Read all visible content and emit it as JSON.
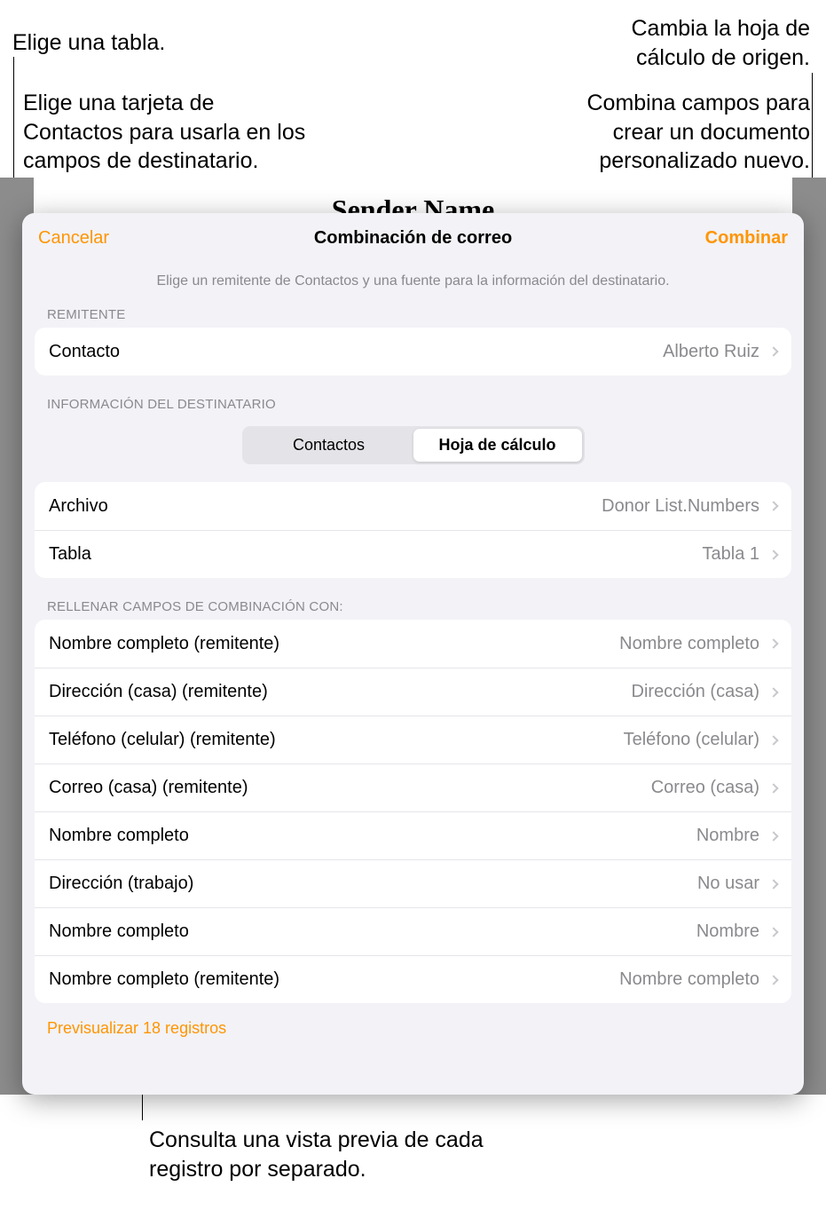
{
  "callouts": {
    "top_left_1": "Elige una tabla.",
    "top_left_2": "Elige una tarjeta de Contactos para usarla en los campos de destinatario.",
    "top_right_1": "Cambia la hoja de cálculo de origen.",
    "top_right_2": "Combina campos para crear un documento personalizado nuevo.",
    "bottom": "Consulta una vista previa de cada registro por separado."
  },
  "document": {
    "title_behind": "Sender Name"
  },
  "sheet": {
    "title": "Combinación de correo",
    "cancel": "Cancelar",
    "combine": "Combinar",
    "subtitle": "Elige un remitente de Contactos y una fuente para la información del destinatario.",
    "sections": {
      "remitente_label": "REMITENTE",
      "info_dest_label": "INFORMACIÓN DEL DESTINATARIO",
      "rellenar_label": "RELLENAR CAMPOS DE COMBINACIÓN CON:"
    },
    "contacto_row": {
      "label": "Contacto",
      "value": "Alberto Ruiz"
    },
    "segmented": {
      "contacts": "Contactos",
      "spreadsheet": "Hoja de cálculo"
    },
    "archivo_row": {
      "label": "Archivo",
      "value": "Donor List.Numbers"
    },
    "tabla_row": {
      "label": "Tabla",
      "value": "Tabla 1"
    },
    "fields": [
      {
        "label": "Nombre completo (remitente)",
        "value": "Nombre completo"
      },
      {
        "label": "Dirección (casa) (remitente)",
        "value": "Dirección (casa)"
      },
      {
        "label": "Teléfono (celular) (remitente)",
        "value": "Teléfono (celular)"
      },
      {
        "label": "Correo (casa) (remitente)",
        "value": "Correo (casa)"
      },
      {
        "label": "Nombre completo",
        "value": "Nombre"
      },
      {
        "label": "Dirección (trabajo)",
        "value": "No usar"
      },
      {
        "label": "Nombre completo",
        "value": "Nombre"
      },
      {
        "label": "Nombre completo (remitente)",
        "value": "Nombre completo"
      }
    ],
    "preview": "Previsualizar 18 registros"
  }
}
